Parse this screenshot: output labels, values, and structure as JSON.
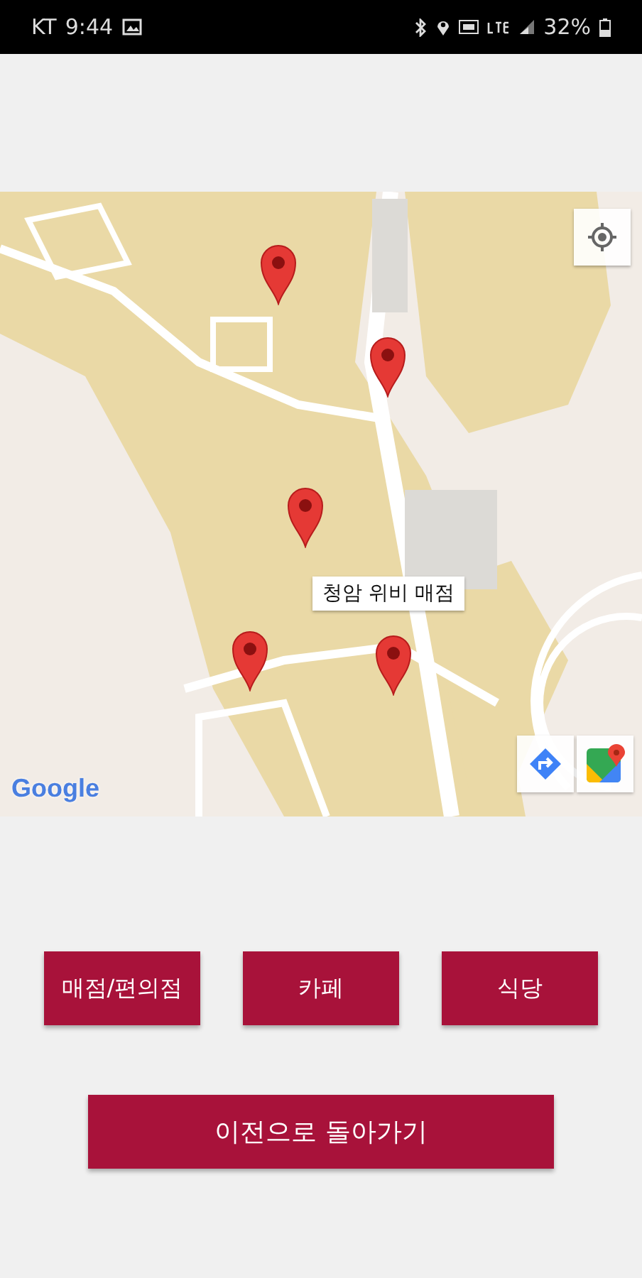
{
  "status_bar": {
    "carrier": "KT",
    "time": "9:44",
    "battery": "32%"
  },
  "map": {
    "info_window": {
      "title": "청암 위비 매점"
    },
    "attribution": "Google"
  },
  "category_buttons": [
    {
      "label": "매점/편의점"
    },
    {
      "label": "카페"
    },
    {
      "label": "식당"
    }
  ],
  "back_button": {
    "label": "이전으로 돌아가기"
  }
}
